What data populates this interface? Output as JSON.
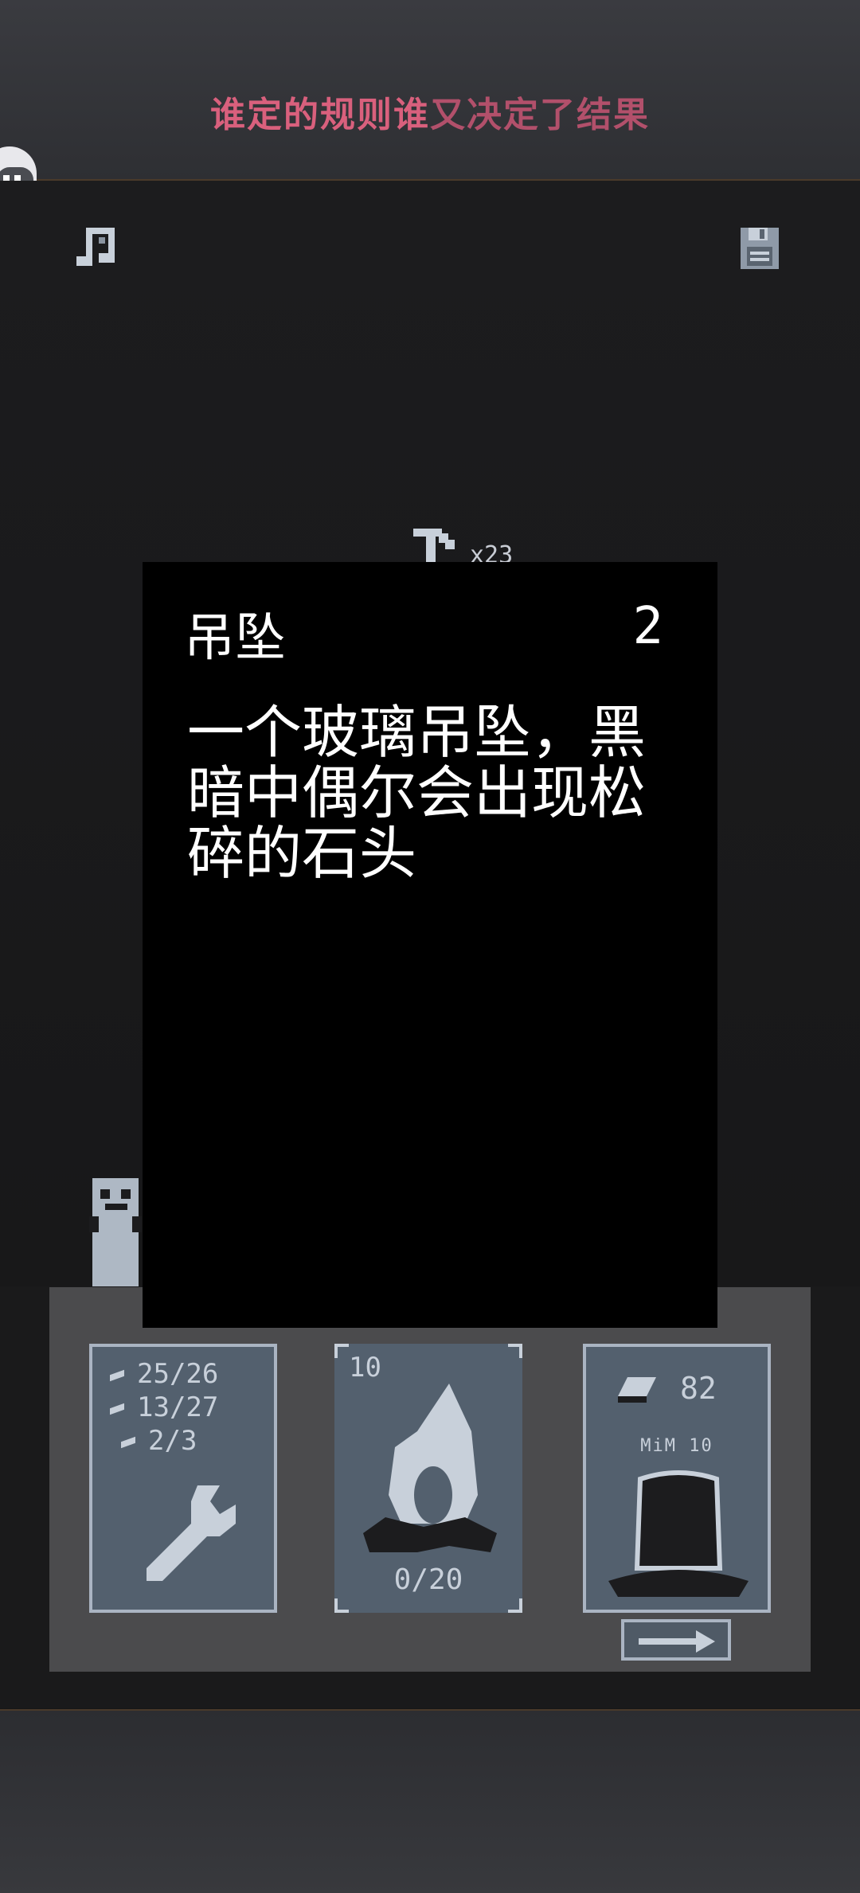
{
  "banner": {
    "bright": "谁定的规则谁",
    "dim": "又决定了结果"
  },
  "hud": {
    "music_icon": "music-note-icon",
    "save_icon": "floppy-disk-icon",
    "pick_count": "x23"
  },
  "cards": {
    "tools": {
      "stone": "25/26",
      "wood": "13/27",
      "gem": "2/3"
    },
    "fire": {
      "level": "10",
      "fuel": "0/20"
    },
    "shop": {
      "qty": "82",
      "tag": "MiM 10"
    }
  },
  "popup": {
    "title": "吊坠",
    "count": "2",
    "description": "一个玻璃吊坠，黑暗中偶尔会出现松碎的石头"
  },
  "colors": {
    "banner_bright": "#d9607d",
    "banner_dim": "#b2506b",
    "card": "#53606e",
    "card_border": "#aab4c2"
  }
}
